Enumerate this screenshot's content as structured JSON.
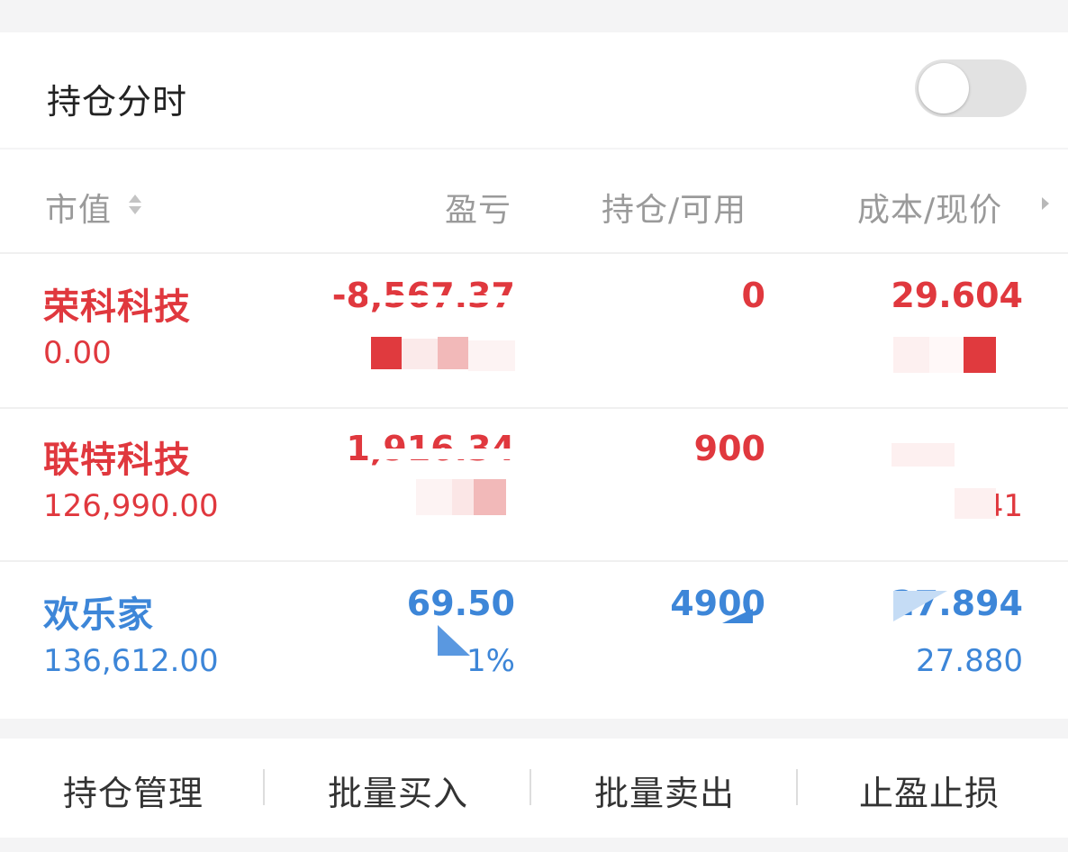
{
  "header": {
    "title": "持仓分时",
    "toggle_on": false
  },
  "columns": {
    "market_value": "市值",
    "profit_loss": "盈亏",
    "hold_available": "持仓/可用",
    "cost_price": "成本/现价"
  },
  "rows": [
    {
      "name": "荣科科技",
      "market_value": "0.00",
      "profit_loss": "-8,567.37",
      "hold": "0",
      "cost": "29.604",
      "color": "#e0383e"
    },
    {
      "name": "联特科技",
      "market_value": "126,990.00",
      "profit_loss": "1,916.34",
      "hold": "900",
      "cost": "",
      "price": "141",
      "color": "#e0383e"
    },
    {
      "name": "欢乐家",
      "market_value": "136,612.00",
      "profit_loss": "69.50",
      "profit_loss_pct": "1%",
      "hold": "4900",
      "cost": "27.894",
      "price": "27.880",
      "color": "#3d86d8"
    }
  ],
  "actions": {
    "position_management": "持仓管理",
    "batch_buy": "批量买入",
    "batch_sell": "批量卖出",
    "stop_profit_loss": "止盈止损"
  },
  "icons": {
    "sort": "sort-updown-icon",
    "more": "chevron-right-icon"
  },
  "colors": {
    "gain": "#e0383e",
    "loss": "#3d86d8",
    "header_text": "#9a9a9a"
  }
}
